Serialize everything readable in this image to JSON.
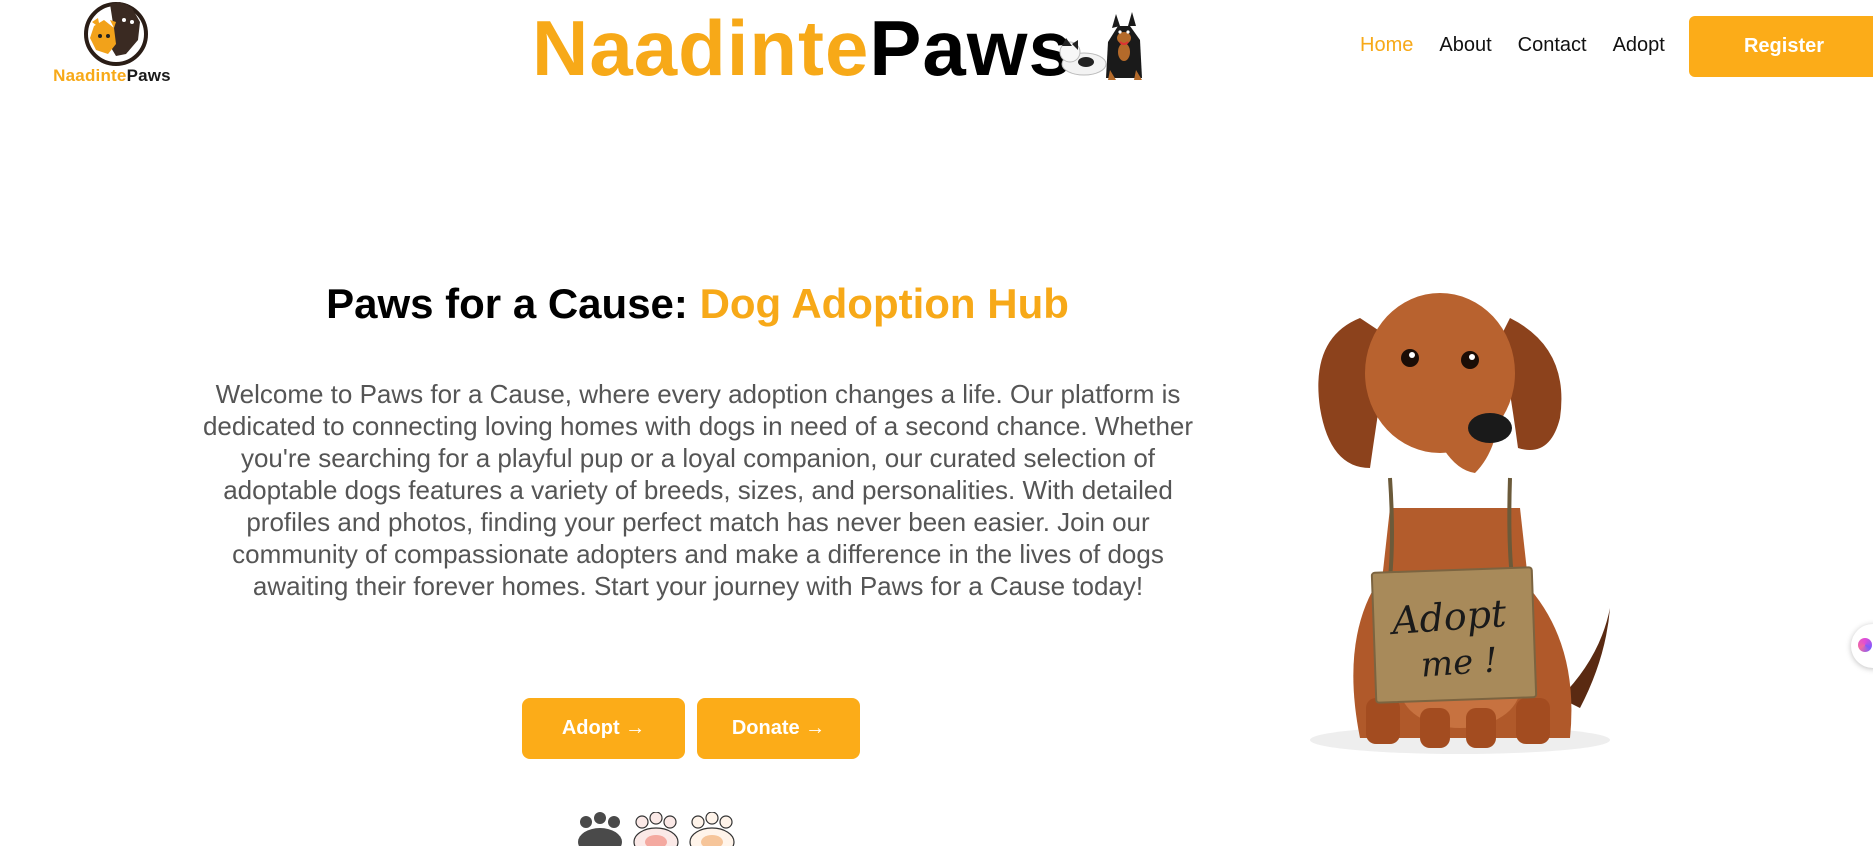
{
  "logo": {
    "text_first": "Naadinte",
    "text_second": "Paws",
    "icon": "dog-cat-logo-icon"
  },
  "site_title": {
    "first": "Naadinte",
    "second": "Paws",
    "illustration": "two-dogs-illustration-icon"
  },
  "nav": {
    "items": [
      {
        "label": "Home",
        "active": true
      },
      {
        "label": "About",
        "active": false
      },
      {
        "label": "Contact",
        "active": false
      },
      {
        "label": "Adopt",
        "active": false
      }
    ],
    "register_label": "Register"
  },
  "hero": {
    "heading_plain": "Paws for a Cause: ",
    "heading_accent": "Dog Adoption Hub",
    "body": "Welcome to Paws for a Cause, where every adoption changes a life. Our platform is dedicated to connecting loving homes with dogs in need of a second chance. Whether you're searching for a playful pup or a loyal companion, our curated selection of adoptable dogs features a variety of breeds, sizes, and personalities. With detailed profiles and photos, finding your perfect match has never been easier. Join our community of compassionate adopters and make a difference in the lives of dogs awaiting their forever homes. Start your journey with Paws for a Cause today!",
    "buttons": [
      {
        "label": "Adopt →"
      },
      {
        "label": "Donate →"
      }
    ],
    "sign_text": "Adopt me!"
  },
  "colors": {
    "accent": "#f7a918",
    "button": "#fcac18",
    "body_text": "#555555"
  }
}
